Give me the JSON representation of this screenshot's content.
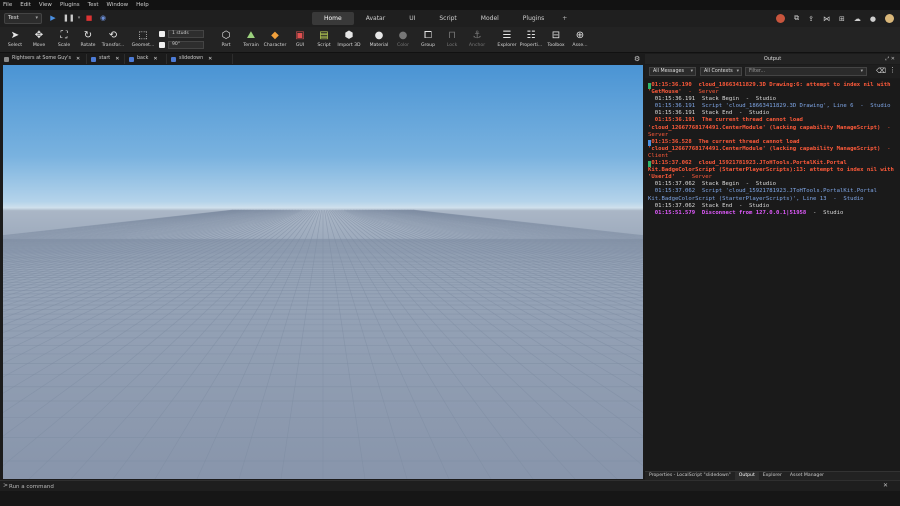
{
  "menu": [
    "File",
    "Edit",
    "View",
    "Plugins",
    "Test",
    "Window",
    "Help"
  ],
  "place": {
    "selected": "Test"
  },
  "top_tabs": [
    {
      "label": "Home",
      "active": true
    },
    {
      "label": "Avatar",
      "active": false
    },
    {
      "label": "UI",
      "active": false
    },
    {
      "label": "Script",
      "active": false
    },
    {
      "label": "Model",
      "active": false
    },
    {
      "label": "Plugins",
      "active": false
    }
  ],
  "top_tab_add": "+",
  "ribbon": {
    "select": "Select",
    "move": "Move",
    "scale": "Scale",
    "rotate": "Rotate",
    "transform": "Transfor...",
    "geometry": "Geomet...",
    "snap_move": "1 studs",
    "snap_rotate": "90°",
    "part": "Part",
    "terrain": "Terrain",
    "character": "Character",
    "gui": "GUI",
    "script": "Script",
    "import3d": "Import 3D",
    "material": "Material",
    "color": "Color",
    "group": "Group",
    "lock": "Lock",
    "anchor": "Anchor",
    "explorer": "Explorer",
    "properties": "Properti...",
    "toolbox": "Toolbox",
    "assets": "Asse..."
  },
  "doc_tabs": [
    {
      "label": "Rightsers at Some Guy's"
    },
    {
      "label": "start"
    },
    {
      "label": "back"
    },
    {
      "label": "slidedown"
    }
  ],
  "output": {
    "title": "Output",
    "messages_filter": "All Messages",
    "contexts_filter": "All Contexts",
    "filter_placeholder": "Filter...",
    "lines": [
      {
        "kind": "err",
        "marker": "#2fb56a",
        "text": "01:15:36.190  cloud_18663411829.3D Drawing:6: attempt to index nil with 'GetMouse'",
        "ctx": "  -  Server"
      },
      {
        "kind": "info",
        "marker": "",
        "text": "  01:15:36.191  Stack Begin",
        "ctx": "  -  Studio"
      },
      {
        "kind": "blue",
        "marker": "",
        "text": "  01:15:36.191  Script 'cloud_18663411829.3D Drawing', Line 6",
        "ctx": "  -  Studio"
      },
      {
        "kind": "info",
        "marker": "",
        "text": "  01:15:36.191  Stack End",
        "ctx": "  -  Studio"
      },
      {
        "kind": "err",
        "marker": "",
        "text": "  01:15:36.191  The current thread cannot load 'cloud_12667768174491.CenterModule' (lacking capability ManageScript)",
        "ctx": "  -  Server"
      },
      {
        "kind": "err",
        "marker": "#4a90e2",
        "text": "01:15:36.528  The current thread cannot load 'cloud_12667768174491.CenterModule' (lacking capability ManageScript)",
        "ctx": "  -  Client"
      },
      {
        "kind": "err",
        "marker": "#2fb56a",
        "text": "01:15:37.062  cloud_15921781923.JToHTools.PortalKit.Portal Kit.BadgeColorScript (StarterPlayerScripts):13: attempt to index nil with 'UserId'",
        "ctx": "  -  Server"
      },
      {
        "kind": "info",
        "marker": "",
        "text": "  01:15:37.062  Stack Begin",
        "ctx": "  -  Studio"
      },
      {
        "kind": "blue",
        "marker": "",
        "text": "  01:15:37.062  Script 'cloud_15921781923.JToHTools.PortalKit.Portal Kit.BadgeColorScript (StarterPlayerScripts)', Line 13",
        "ctx": "  -  Studio"
      },
      {
        "kind": "info",
        "marker": "",
        "text": "  01:15:37.062  Stack End",
        "ctx": "  -  Studio"
      },
      {
        "kind": "magenta",
        "marker": "",
        "text": "  01:15:51.579  Disconnect from 127.0.0.1|51958",
        "ctx": "  -  Studio"
      }
    ]
  },
  "bottom_tabs": [
    {
      "label": "Properties - LocalScript \"slidedown\"",
      "active": false
    },
    {
      "label": "Output",
      "active": true
    },
    {
      "label": "Explorer",
      "active": false
    },
    {
      "label": "Asset Manager",
      "active": false
    }
  ],
  "command": {
    "placeholder": "Run a command",
    "prompt": ">"
  },
  "colors": {
    "error": "#ff5a3a",
    "stack": "#7fa6e6",
    "disconnect": "#e25bff",
    "accent": "#4a90e2"
  }
}
